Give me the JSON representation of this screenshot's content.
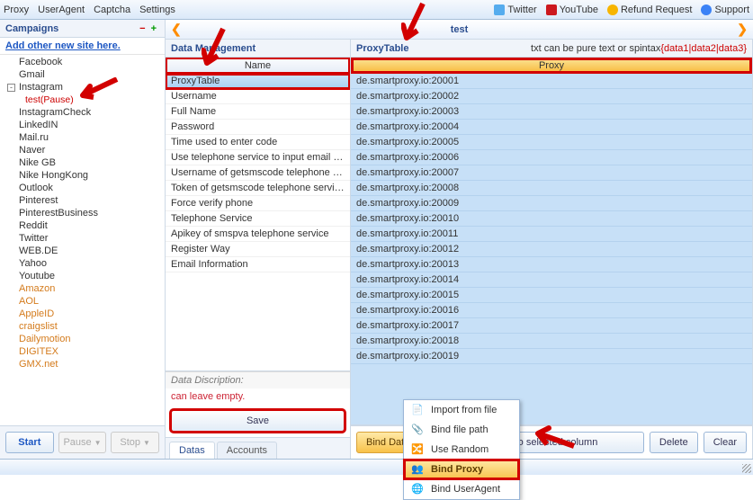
{
  "topbar": {
    "left": [
      "Proxy",
      "UserAgent",
      "Captcha",
      "Settings"
    ],
    "right": [
      {
        "label": "Twitter",
        "icon": "twitter-icon"
      },
      {
        "label": "YouTube",
        "icon": "youtube-icon"
      },
      {
        "label": "Refund Request",
        "icon": "refund-icon"
      },
      {
        "label": "Support",
        "icon": "support-icon"
      }
    ]
  },
  "campaigns": {
    "title": "Campaigns",
    "add_label": "Add other new site here.",
    "items": [
      {
        "label": "Facebook"
      },
      {
        "label": "Gmail"
      },
      {
        "label": "Instagram",
        "expanded": true,
        "child": "test(Pause)"
      },
      {
        "label": "InstagramCheck"
      },
      {
        "label": "LinkedIN"
      },
      {
        "label": "Mail.ru"
      },
      {
        "label": "Naver"
      },
      {
        "label": "Nike GB"
      },
      {
        "label": "Nike HongKong"
      },
      {
        "label": "Outlook"
      },
      {
        "label": "Pinterest"
      },
      {
        "label": "PinterestBusiness"
      },
      {
        "label": "Reddit"
      },
      {
        "label": "Twitter"
      },
      {
        "label": "WEB.DE"
      },
      {
        "label": "Yahoo"
      },
      {
        "label": "Youtube"
      },
      {
        "label": "Amazon",
        "orange": true
      },
      {
        "label": "AOL",
        "orange": true
      },
      {
        "label": "AppleID",
        "orange": true
      },
      {
        "label": "craigslist",
        "orange": true
      },
      {
        "label": "Dailymotion",
        "orange": true
      },
      {
        "label": "DIGITEX",
        "orange": true
      },
      {
        "label": "GMX.net",
        "orange": true
      }
    ],
    "buttons": {
      "start": "Start",
      "pause": "Pause",
      "stop": "Stop"
    }
  },
  "work": {
    "title": "test",
    "nav_prev": "❮",
    "nav_next": "❯"
  },
  "dm": {
    "title": "Data Management",
    "col": "Name",
    "rows": [
      "ProxyTable",
      "Username",
      "Full Name",
      "Password",
      "Time used to enter code",
      "Use telephone service to input email or phone nu...",
      "Username of getsmscode telephone service",
      "Token of getsmscode telephone service",
      "Force verify phone",
      "Telephone Service",
      "Apikey of smspva telephone service",
      "Register Way",
      "Email Information"
    ],
    "desc_label": "Data Discription:",
    "desc_value": "can leave empty.",
    "save": "Save",
    "tabs": [
      "Datas",
      "Accounts"
    ]
  },
  "pt": {
    "title": "ProxyTable",
    "hint_plain": "txt can be pure text or spintax",
    "hint_spin": "{data1|data2|data3}",
    "col": "Proxy",
    "rows": [
      "de.smartproxy.io:20001",
      "de.smartproxy.io:20002",
      "de.smartproxy.io:20003",
      "de.smartproxy.io:20004",
      "de.smartproxy.io:20005",
      "de.smartproxy.io:20006",
      "de.smartproxy.io:20007",
      "de.smartproxy.io:20008",
      "de.smartproxy.io:20009",
      "de.smartproxy.io:20010",
      "de.smartproxy.io:20011",
      "de.smartproxy.io:20012",
      "de.smartproxy.io:20013",
      "de.smartproxy.io:20014",
      "de.smartproxy.io:20015",
      "de.smartproxy.io:20016",
      "de.smartproxy.io:20017",
      "de.smartproxy.io:20018",
      "de.smartproxy.io:20019"
    ],
    "buttons": {
      "bind": "Bind Data",
      "paste": "Paste to selected column",
      "delete": "Delete",
      "clear": "Clear"
    }
  },
  "menu": {
    "items": [
      {
        "label": "Import from file",
        "icon": "file-icon"
      },
      {
        "label": "Bind file path",
        "icon": "link-icon"
      },
      {
        "label": "Use Random",
        "icon": "shuffle-icon"
      },
      {
        "label": "Bind Proxy",
        "icon": "people-icon",
        "hl": true
      },
      {
        "label": "Bind UserAgent",
        "icon": "globe-icon"
      }
    ]
  }
}
